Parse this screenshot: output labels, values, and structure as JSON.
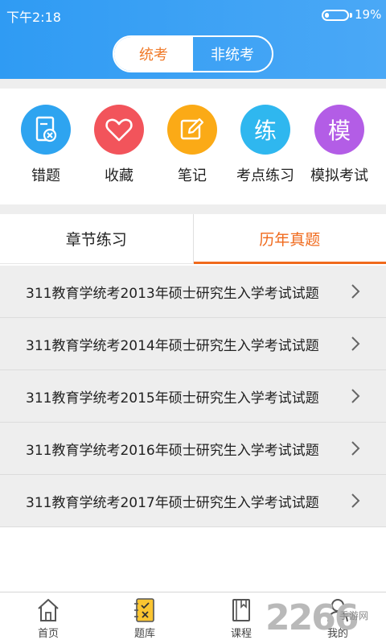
{
  "status_bar": {
    "time": "下午2:18",
    "battery_percent": "19%",
    "battery_level": 0.19
  },
  "segment": {
    "options": [
      "统考",
      "非统考"
    ],
    "selected": "统考"
  },
  "shortcuts": [
    {
      "label": "错题",
      "icon": "wrong-book-icon",
      "color": "#2ea4f0"
    },
    {
      "label": "收藏",
      "icon": "heart-icon",
      "color": "#f2545b"
    },
    {
      "label": "笔记",
      "icon": "edit-note-icon",
      "color": "#fbaa16"
    },
    {
      "label": "考点练习",
      "icon": "练",
      "color": "#2fb7ef"
    },
    {
      "label": "模拟考试",
      "icon": "模",
      "color": "#b35de6"
    }
  ],
  "tabs": {
    "items": [
      "章节练习",
      "历年真题"
    ],
    "selected": "历年真题"
  },
  "list": [
    "311教育学统考2013年硕士研究生入学考试试题",
    "311教育学统考2014年硕士研究生入学考试试题",
    "311教育学统考2015年硕士研究生入学考试试题",
    "311教育学统考2016年硕士研究生入学考试试题",
    "311教育学统考2017年硕士研究生入学考试试题"
  ],
  "bottom_nav": [
    {
      "label": "首页",
      "icon": "home-icon"
    },
    {
      "label": "题库",
      "icon": "question-bank-icon"
    },
    {
      "label": "课程",
      "icon": "book-icon"
    },
    {
      "label": "我的",
      "icon": "user-icon"
    }
  ],
  "watermark": {
    "number": "2266",
    "text": "手游网"
  },
  "colors": {
    "header_blue": "#2f9bf3",
    "accent_orange": "#f06a1c"
  }
}
